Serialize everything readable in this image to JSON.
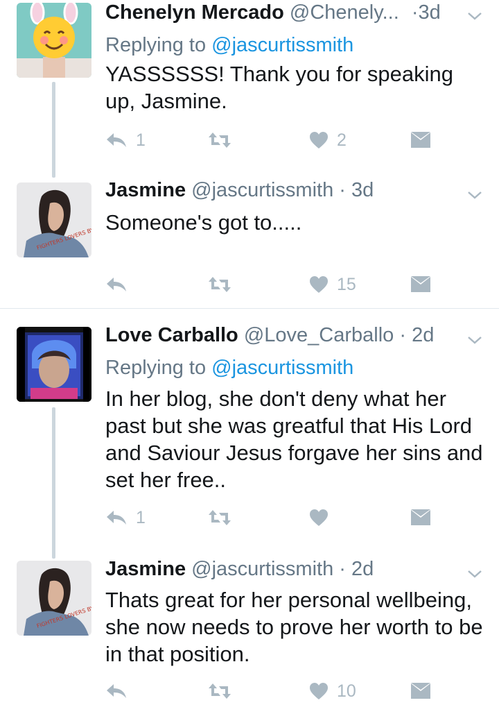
{
  "tweets": [
    {
      "name": "Chenelyn Mercado",
      "handle": "@Chenely...",
      "separator": "·",
      "time": "3d",
      "reply_prefix": "Replying to",
      "reply_mention": "@jascurtissmith",
      "text": "YASSSSSS! Thank you for speaking up, Jasmine.",
      "reply_count": "1",
      "retweet_count": "",
      "like_count": "2"
    },
    {
      "name": "Jasmine",
      "handle": "@jascurtissmith",
      "separator": "·",
      "time": "3d",
      "text": "Someone's got to.....",
      "reply_count": "",
      "retweet_count": "",
      "like_count": "15"
    },
    {
      "name": "Love Carballo",
      "handle": "@Love_Carballo",
      "separator": "·",
      "time": "2d",
      "reply_prefix": "Replying to",
      "reply_mention": "@jascurtissmith",
      "text": "In her blog, she don't deny what her past but she was greatful that His Lord and Saviour Jesus forgave her sins and set her free..",
      "reply_count": "1",
      "retweet_count": "",
      "like_count": ""
    },
    {
      "name": "Jasmine",
      "handle": "@jascurtissmith",
      "separator": "·",
      "time": "2d",
      "text": "Thats great for her personal wellbeing, she now needs to prove her worth to be in that position.",
      "reply_count": "",
      "retweet_count": "",
      "like_count": "10"
    }
  ],
  "avatars": {
    "jasmine_jacket_text": "FIGHTERS LOVERS BY NIGHT"
  },
  "colors": {
    "link": "#1b95e0",
    "secondary_text": "#657786",
    "action_icon": "#aab8c2",
    "thread_line": "#ccd6dd",
    "divider": "#e1e8ed"
  },
  "icons": {
    "reply": "reply-icon",
    "retweet": "retweet-icon",
    "like": "heart-icon",
    "dm": "envelope-icon",
    "more": "chevron-down-icon"
  }
}
